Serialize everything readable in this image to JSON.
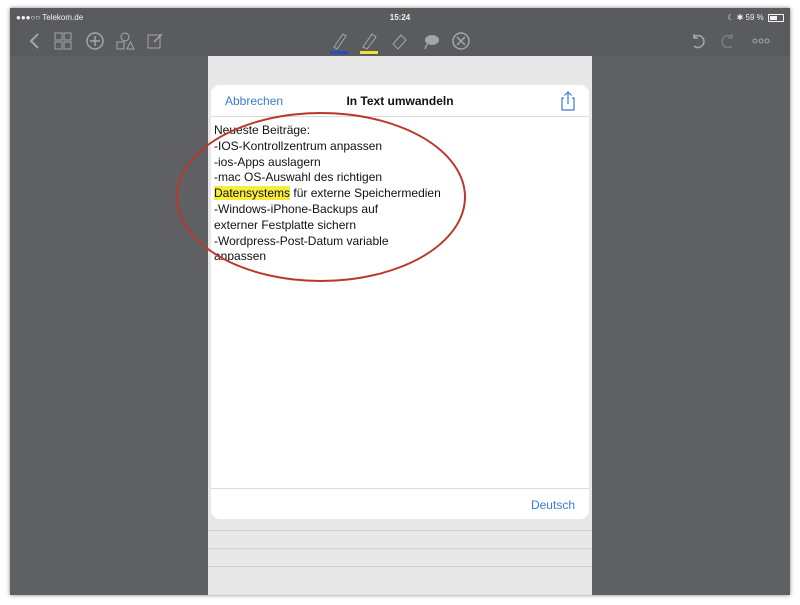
{
  "status_bar": {
    "carrier": "●●●○○ Telekom.de",
    "time": "15:24",
    "battery": "59 %"
  },
  "toolbar": {
    "icons": [
      "back-chevron-icon",
      "grid-icon",
      "add-circle-icon",
      "shapes-icon",
      "edit-icon",
      "pen-icon",
      "highlighter-icon",
      "eraser-icon",
      "lasso-icon",
      "close-circle-icon",
      "undo-icon",
      "redo-icon",
      "more-icon"
    ]
  },
  "dialog": {
    "cancel_label": "Abbrechen",
    "title": "In Text umwandeln",
    "lines": [
      "Neueste Beiträge:",
      "-IOS-Kontrollzentrum anpassen",
      "-ios-Apps auslagern",
      "-mac OS-Auswahl des richtigen",
      "",
      "-Windows-iPhone-Backups auf",
      "externer Festplatte sichern",
      "-Wordpress-Post-Datum variable",
      "anpassen"
    ],
    "highlighted_word": "Datensystems",
    "line5_rest": " für externe Speichermedien",
    "language_label": "Deutsch"
  },
  "colors": {
    "accent": "#3a7bd5",
    "highlight": "#f6ee3a",
    "annotation": "#b9382b",
    "pen_blue": "#1f4fb8",
    "pen_yellow": "#e9e23a"
  }
}
